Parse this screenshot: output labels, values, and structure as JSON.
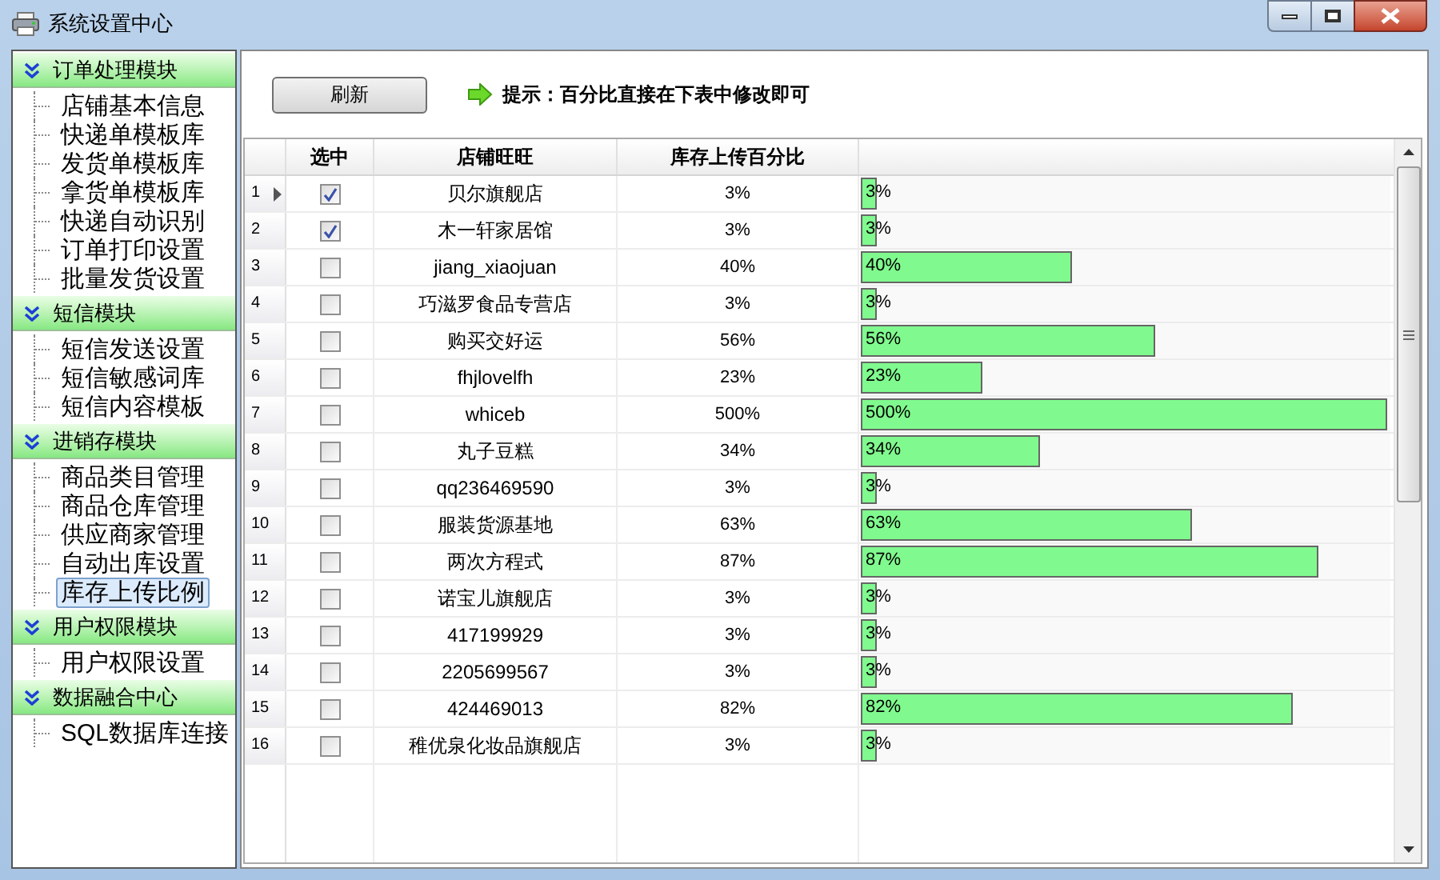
{
  "window": {
    "title": "系统设置中心"
  },
  "sidebar": [
    {
      "title": "订单处理模块",
      "expanded": true,
      "items": [
        {
          "label": "店铺基本信息",
          "selected": false
        },
        {
          "label": "快递单模板库",
          "selected": false
        },
        {
          "label": "发货单模板库",
          "selected": false
        },
        {
          "label": "拿货单模板库",
          "selected": false
        },
        {
          "label": "快递自动识别",
          "selected": false
        },
        {
          "label": "订单打印设置",
          "selected": false
        },
        {
          "label": "批量发货设置",
          "selected": false
        }
      ]
    },
    {
      "title": "短信模块",
      "expanded": true,
      "items": [
        {
          "label": "短信发送设置",
          "selected": false
        },
        {
          "label": "短信敏感词库",
          "selected": false
        },
        {
          "label": "短信内容模板",
          "selected": false
        }
      ]
    },
    {
      "title": "进销存模块",
      "expanded": true,
      "items": [
        {
          "label": "商品类目管理",
          "selected": false
        },
        {
          "label": "商品仓库管理",
          "selected": false
        },
        {
          "label": "供应商家管理",
          "selected": false
        },
        {
          "label": "自动出库设置",
          "selected": false
        },
        {
          "label": "库存上传比例",
          "selected": true
        }
      ]
    },
    {
      "title": "用户权限模块",
      "expanded": true,
      "items": [
        {
          "label": "用户权限设置",
          "selected": false
        }
      ]
    },
    {
      "title": "数据融合中心",
      "expanded": true,
      "items": [
        {
          "label": "SQL数据库连接",
          "selected": false
        }
      ]
    }
  ],
  "toolbar": {
    "refresh_button": "刷新",
    "hint": "提示：百分比直接在下表中修改即可"
  },
  "table": {
    "columns": [
      "选中",
      "店铺旺旺",
      "库存上传百分比"
    ],
    "rows": [
      {
        "index": "1",
        "current": true,
        "checked": true,
        "shop": "贝尔旗舰店",
        "percent": "3%",
        "bar_label": "3%",
        "level": 0.03
      },
      {
        "index": "2",
        "current": false,
        "checked": true,
        "shop": "木一轩家居馆",
        "percent": "3%",
        "bar_label": "3%",
        "level": 0.03
      },
      {
        "index": "3",
        "current": false,
        "checked": false,
        "shop": "jiang_xiaojuan",
        "percent": "40%",
        "bar_label": "40%",
        "level": 0.4
      },
      {
        "index": "4",
        "current": false,
        "checked": false,
        "shop": "巧滋罗食品专营店",
        "percent": "3%",
        "bar_label": "3%",
        "level": 0.03
      },
      {
        "index": "5",
        "current": false,
        "checked": false,
        "shop": "购买交好运",
        "percent": "56%",
        "bar_label": "56%",
        "level": 0.56
      },
      {
        "index": "6",
        "current": false,
        "checked": false,
        "shop": "fhjlovelfh",
        "percent": "23%",
        "bar_label": "23%",
        "level": 0.23
      },
      {
        "index": "7",
        "current": false,
        "checked": false,
        "shop": "whiceb",
        "percent": "500%",
        "bar_label": "500%",
        "level": 1
      },
      {
        "index": "8",
        "current": false,
        "checked": false,
        "shop": "丸子豆糕",
        "percent": "34%",
        "bar_label": "34%",
        "level": 0.34
      },
      {
        "index": "9",
        "current": false,
        "checked": false,
        "shop": "qq236469590",
        "percent": "3%",
        "bar_label": "3%",
        "level": 0.03
      },
      {
        "index": "10",
        "current": false,
        "checked": false,
        "shop": "服装货源基地",
        "percent": "63%",
        "bar_label": "63%",
        "level": 0.63
      },
      {
        "index": "11",
        "current": false,
        "checked": false,
        "shop": "两次方程式",
        "percent": "87%",
        "bar_label": "87%",
        "level": 0.87
      },
      {
        "index": "12",
        "current": false,
        "checked": false,
        "shop": "诺宝儿旗舰店",
        "percent": "3%",
        "bar_label": "3%",
        "level": 0.03
      },
      {
        "index": "13",
        "current": false,
        "checked": false,
        "shop": "417199929",
        "percent": "3%",
        "bar_label": "3%",
        "level": 0.03
      },
      {
        "index": "14",
        "current": false,
        "checked": false,
        "shop": "2205699567",
        "percent": "3%",
        "bar_label": "3%",
        "level": 0.03
      },
      {
        "index": "15",
        "current": false,
        "checked": false,
        "shop": "424469013",
        "percent": "82%",
        "bar_label": "82%",
        "level": 0.82
      },
      {
        "index": "16",
        "current": false,
        "checked": false,
        "shop": "稚优泉化妆品旗舰店",
        "percent": "3%",
        "bar_label": "3%",
        "level": 0.03
      }
    ]
  }
}
